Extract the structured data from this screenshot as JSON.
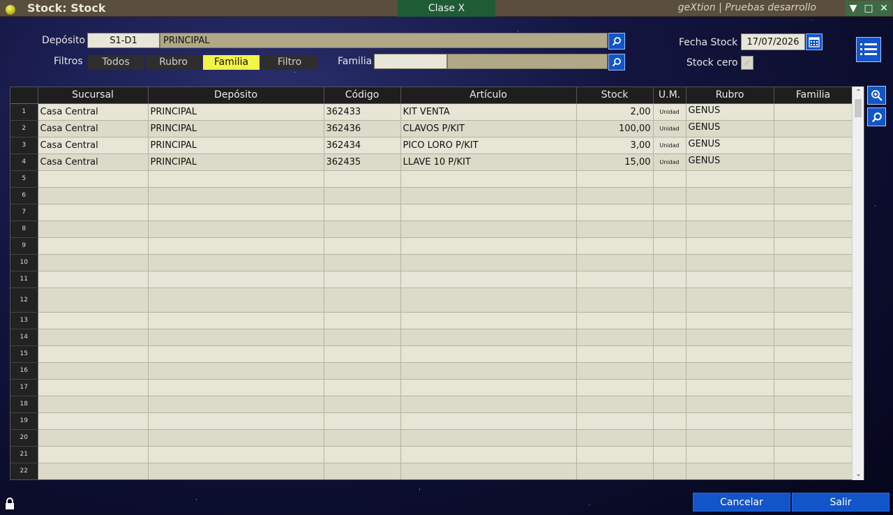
{
  "window": {
    "title": "Stock: Stock",
    "center_label": "Clase X",
    "right_label": "geXtion | Pruebas desarrollo",
    "controls": [
      "minimize-icon",
      "maximize-icon",
      "close-icon"
    ]
  },
  "form": {
    "deposito_label": "Depósito",
    "deposito_code": "S1-D1",
    "deposito_desc": "PRINCIPAL",
    "filtros_label": "Filtros",
    "filters": [
      {
        "label": "Todos",
        "active": false
      },
      {
        "label": "Rubro",
        "active": false
      },
      {
        "label": "Familia",
        "active": true
      },
      {
        "label": "Filtro",
        "active": false
      }
    ],
    "familia_label": "Familia",
    "familia_code": "",
    "familia_desc": "",
    "fecha_label": "Fecha Stock",
    "fecha_value": "17/07/2026",
    "stock_cero_label": "Stock cero",
    "stock_cero_checked": true
  },
  "grid": {
    "columns": [
      "Sucursal",
      "Depósito",
      "Código",
      "Artículo",
      "Stock",
      "U.M.",
      "Rubro",
      "Familia"
    ],
    "rows": [
      {
        "n": "1",
        "sucursal": "Casa Central",
        "deposito": "PRINCIPAL",
        "codigo": "362433",
        "articulo": "KIT VENTA",
        "stock": "2,00",
        "um": "Unidad",
        "rubro": "GENUS",
        "familia": ""
      },
      {
        "n": "2",
        "sucursal": "Casa Central",
        "deposito": "PRINCIPAL",
        "codigo": "362436",
        "articulo": "CLAVOS P/KIT",
        "stock": "100,00",
        "um": "Unidad",
        "rubro": "GENUS",
        "familia": ""
      },
      {
        "n": "3",
        "sucursal": "Casa Central",
        "deposito": "PRINCIPAL",
        "codigo": "362434",
        "articulo": "PICO LORO P/KIT",
        "stock": "3,00",
        "um": "Unidad",
        "rubro": "GENUS",
        "familia": ""
      },
      {
        "n": "4",
        "sucursal": "Casa Central",
        "deposito": "PRINCIPAL",
        "codigo": "362435",
        "articulo": "LLAVE 10 P/KIT",
        "stock": "15,00",
        "um": "Unidad",
        "rubro": "GENUS",
        "familia": ""
      }
    ],
    "empty_row_numbers": [
      "5",
      "6",
      "7",
      "8",
      "9",
      "10",
      "11",
      "12",
      "13",
      "14",
      "15",
      "16",
      "17",
      "18",
      "19",
      "20",
      "21",
      "22"
    ]
  },
  "buttons": {
    "cancelar": "Cancelar",
    "salir": "Salir"
  },
  "colors": {
    "accent_blue": "#1255c8",
    "active_filter": "#f4f447",
    "title_green": "#1f5c36"
  }
}
